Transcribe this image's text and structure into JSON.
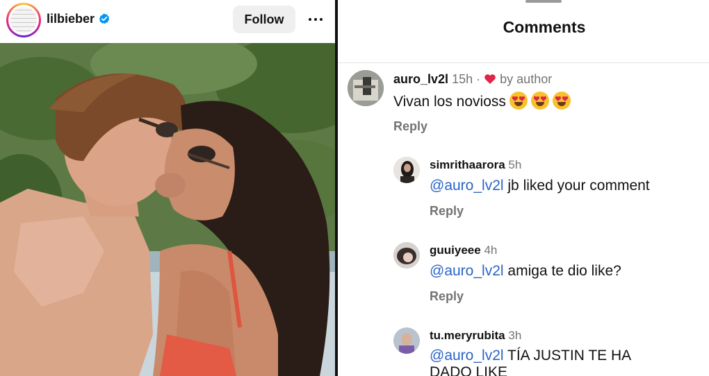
{
  "post": {
    "username": "lilbieber",
    "follow_label": "Follow"
  },
  "comments_sheet": {
    "title": "Comments",
    "comments": [
      {
        "username": "auro_lv2l",
        "time": "15h",
        "liked_by": "by author",
        "text": "Vivan los novioss",
        "emojis": [
          "heart-eyes",
          "heart-eyes",
          "heart-eyes"
        ],
        "reply_label": "Reply"
      },
      {
        "username": "simrithaarora",
        "time": "5h",
        "mention": "@auro_lv2l",
        "text": "jb liked your comment",
        "reply_label": "Reply"
      },
      {
        "username": "guuiyeee",
        "time": "4h",
        "mention": "@auro_lv2l",
        "text": "amiga te dio like?",
        "reply_label": "Reply"
      },
      {
        "username": "tu.meryrubita",
        "time": "3h",
        "mention": "@auro_lv2l",
        "text": "TÍA JUSTIN TE HA",
        "text_line2": "DADO LIKE"
      }
    ]
  },
  "colors": {
    "mention": "#2a64c5",
    "heart": "#e0244a",
    "verified": "#0095f6",
    "muted": "#737373"
  }
}
